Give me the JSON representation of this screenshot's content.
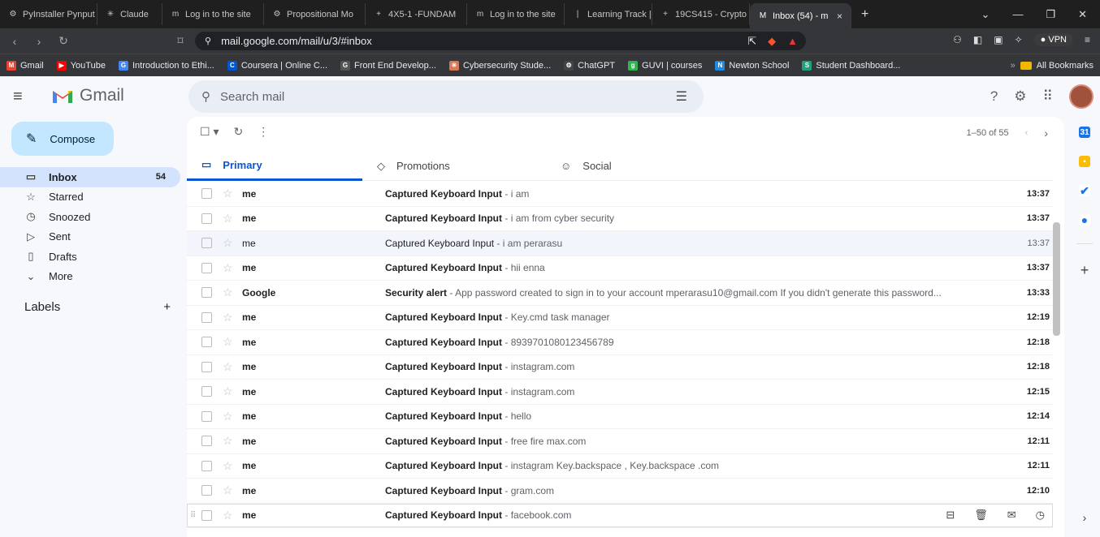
{
  "browser": {
    "tabs": [
      {
        "title": "PyInstaller Pynput",
        "icon": "⚙",
        "active": false
      },
      {
        "title": "Claude",
        "icon": "✳",
        "active": false
      },
      {
        "title": "Log in to the site",
        "icon": "m",
        "active": false
      },
      {
        "title": "Propositional Mo",
        "icon": "⚙",
        "active": false
      },
      {
        "title": "4X5-1 -FUNDAM",
        "icon": "+",
        "active": false
      },
      {
        "title": "Log in to the site",
        "icon": "m",
        "active": false
      },
      {
        "title": "Learning Track | l",
        "icon": "|",
        "active": false
      },
      {
        "title": "19CS415 - Crypto",
        "icon": "+",
        "active": false
      },
      {
        "title": "Inbox (54) - m",
        "icon": "M",
        "active": true
      }
    ],
    "url": "mail.google.com/mail/u/3/#inbox",
    "vpn_label": "VPN",
    "bookmarks": [
      {
        "label": "Gmail",
        "color": "#ea4335",
        "icon": "M"
      },
      {
        "label": "YouTube",
        "color": "#ff0000",
        "icon": "▶"
      },
      {
        "label": "Introduction to Ethi...",
        "color": "#4285f4",
        "icon": "G"
      },
      {
        "label": "Coursera | Online C...",
        "color": "#0056d2",
        "icon": "C"
      },
      {
        "label": "Front End Develop...",
        "color": "#555",
        "icon": "G"
      },
      {
        "label": "Cybersecurity Stude...",
        "color": "#d97757",
        "icon": "✳"
      },
      {
        "label": "ChatGPT",
        "color": "#444",
        "icon": "⚙"
      },
      {
        "label": "GUVI | courses",
        "color": "#2db84d",
        "icon": "g"
      },
      {
        "label": "Newton School",
        "color": "#1e88e5",
        "icon": "N"
      },
      {
        "label": "Student Dashboard...",
        "color": "#21a179",
        "icon": "S"
      }
    ],
    "all_bookmarks": "All Bookmarks"
  },
  "gmail": {
    "brand": "Gmail",
    "search_placeholder": "Search mail",
    "compose_label": "Compose",
    "nav": [
      {
        "label": "Inbox",
        "icon": "▭",
        "count": "54",
        "active": true
      },
      {
        "label": "Starred",
        "icon": "☆",
        "count": "",
        "active": false
      },
      {
        "label": "Snoozed",
        "icon": "◷",
        "count": "",
        "active": false
      },
      {
        "label": "Sent",
        "icon": "▷",
        "count": "",
        "active": false
      },
      {
        "label": "Drafts",
        "icon": "▯",
        "count": "",
        "active": false
      },
      {
        "label": "More",
        "icon": "⌄",
        "count": "",
        "active": false
      }
    ],
    "labels_title": "Labels",
    "pager": "1–50 of 55",
    "tabs": [
      {
        "label": "Primary",
        "icon": "▭",
        "active": true
      },
      {
        "label": "Promotions",
        "icon": "◇",
        "active": false
      },
      {
        "label": "Social",
        "icon": "☺",
        "active": false
      }
    ],
    "emails": [
      {
        "sender": "me",
        "subject": "Captured Keyboard Input",
        "snippet": "i am",
        "time": "13:37",
        "read": false
      },
      {
        "sender": "me",
        "subject": "Captured Keyboard Input",
        "snippet": "i am from cyber security",
        "time": "13:37",
        "read": false
      },
      {
        "sender": "me",
        "subject": "Captured Keyboard Input",
        "snippet": "i am perarasu",
        "time": "13:37",
        "read": true
      },
      {
        "sender": "me",
        "subject": "Captured Keyboard Input",
        "snippet": "hii enna",
        "time": "13:37",
        "read": false
      },
      {
        "sender": "Google",
        "subject": "Security alert",
        "snippet": "App password created to sign in to your account mperarasu10@gmail.com If you didn't generate this password...",
        "time": "13:33",
        "read": false
      },
      {
        "sender": "me",
        "subject": "Captured Keyboard Input",
        "snippet": "Key.cmd task manager",
        "time": "12:19",
        "read": false
      },
      {
        "sender": "me",
        "subject": "Captured Keyboard Input",
        "snippet": "8939701080123456789",
        "time": "12:18",
        "read": false
      },
      {
        "sender": "me",
        "subject": "Captured Keyboard Input",
        "snippet": "instagram.com",
        "time": "12:18",
        "read": false
      },
      {
        "sender": "me",
        "subject": "Captured Keyboard Input",
        "snippet": "instagram.com",
        "time": "12:15",
        "read": false
      },
      {
        "sender": "me",
        "subject": "Captured Keyboard Input",
        "snippet": "hello",
        "time": "12:14",
        "read": false
      },
      {
        "sender": "me",
        "subject": "Captured Keyboard Input",
        "snippet": "free fire max.com",
        "time": "12:11",
        "read": false
      },
      {
        "sender": "me",
        "subject": "Captured Keyboard Input",
        "snippet": "instagram Key.backspace , Key.backspace .com",
        "time": "12:11",
        "read": false
      },
      {
        "sender": "me",
        "subject": "Captured Keyboard Input",
        "snippet": "gram.com",
        "time": "12:10",
        "read": false
      },
      {
        "sender": "me",
        "subject": "Captured Keyboard Input",
        "snippet": "facebook.com",
        "time": "",
        "read": false,
        "hover": true
      }
    ]
  }
}
